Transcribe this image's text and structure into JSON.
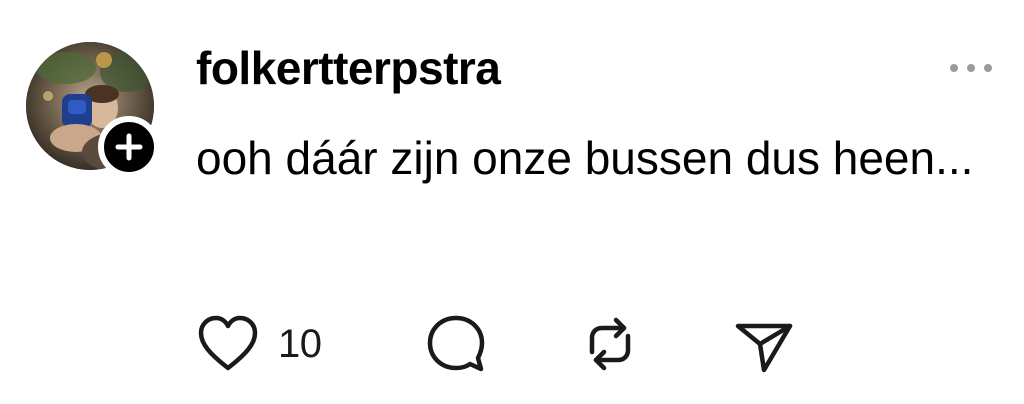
{
  "post": {
    "author": {
      "username": "folkertterpstra",
      "avatar_icon": "avatar-photo",
      "follow_icon": "plus-icon"
    },
    "more_icon": "more-horizontal-icon",
    "text": "ooh dáár zijn onze bussen dus heen...",
    "actions": {
      "like": {
        "icon": "heart-icon",
        "count": "10"
      },
      "reply": {
        "icon": "reply-bubble-icon"
      },
      "repost": {
        "icon": "repost-arrows-icon"
      },
      "share": {
        "icon": "paper-plane-icon"
      }
    }
  },
  "colors": {
    "text": "#000000",
    "icon": "#1a1a1a",
    "muted": "#9a9a9a",
    "background": "#ffffff",
    "badge": "#000000"
  }
}
